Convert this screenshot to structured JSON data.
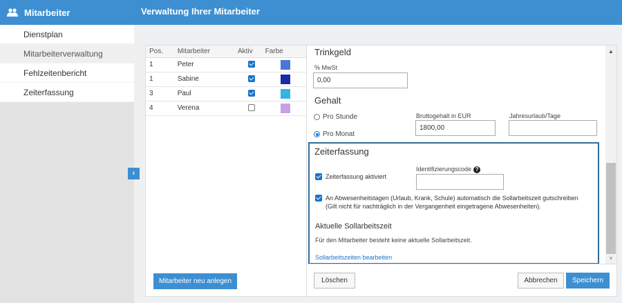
{
  "sidebar": {
    "title": "Mitarbeiter",
    "icon": "users-icon",
    "items": [
      {
        "label": "Dienstplan"
      },
      {
        "label": "Mitarbeiterverwaltung"
      },
      {
        "label": "Fehlzeitenbericht"
      },
      {
        "label": "Zeiterfassung"
      }
    ],
    "active_item": "Mitarbeiterverwaltung"
  },
  "header": {
    "title": "Verwaltung Ihrer Mitarbeiter"
  },
  "list": {
    "columns": {
      "pos": "Pos.",
      "name": "Mitarbeiter",
      "active": "Aktiv",
      "color": "Farbe"
    },
    "rows": [
      {
        "pos": "1",
        "name": "Peter",
        "active": true,
        "color": "#4a76d8"
      },
      {
        "pos": "1",
        "name": "Sabine",
        "active": true,
        "color": "#1a2aa8"
      },
      {
        "pos": "3",
        "name": "Paul",
        "active": true,
        "color": "#33b5e0"
      },
      {
        "pos": "4",
        "name": "Verena",
        "active": false,
        "color": "#c7a0e8"
      }
    ],
    "add_button": "Mitarbeiter neu anlegen"
  },
  "detail": {
    "trinkgeld": {
      "title": "Trinkgeld",
      "mwst_label": "% MwSt",
      "mwst_value": "0,00"
    },
    "gehalt": {
      "title": "Gehalt",
      "option_hour": "Pro Stunde",
      "option_month": "Pro Monat",
      "selected": "Pro Monat",
      "brutto_label": "Bruttogehalt in EUR",
      "brutto_value": "1800,00",
      "urlaub_label": "Jahresurlaub/Tage",
      "urlaub_value": ""
    },
    "zeiterfassung": {
      "title": "Zeiterfassung",
      "enable_label": "Zeiterfassung aktiviert",
      "enable_checked": true,
      "id_label": "Identifizierungscode",
      "id_value": "",
      "auto_label": "An Abwesenheitstagen (Urlaub, Krank, Schule) automatisch die Sollarbeitszeit gutschreiben",
      "auto_note": "(Gilt nicht für nachträglich in der Vergangenheit eingetragene Abwesenheiten).",
      "auto_checked": true,
      "soll_title": "Aktuelle Sollarbeitszeit",
      "soll_text": "Für den Mitarbeiter besteht keine aktuelle Sollarbeitszeit.",
      "soll_link": "Sollarbeitszeiten bearbeiten"
    },
    "buttons": {
      "delete": "Löschen",
      "cancel": "Abbrechen",
      "save": "Speichern"
    }
  },
  "colors": {
    "accent": "#3d8fd1",
    "checkbox": "#1a73c9",
    "highlight_border": "#2f6e9a"
  }
}
